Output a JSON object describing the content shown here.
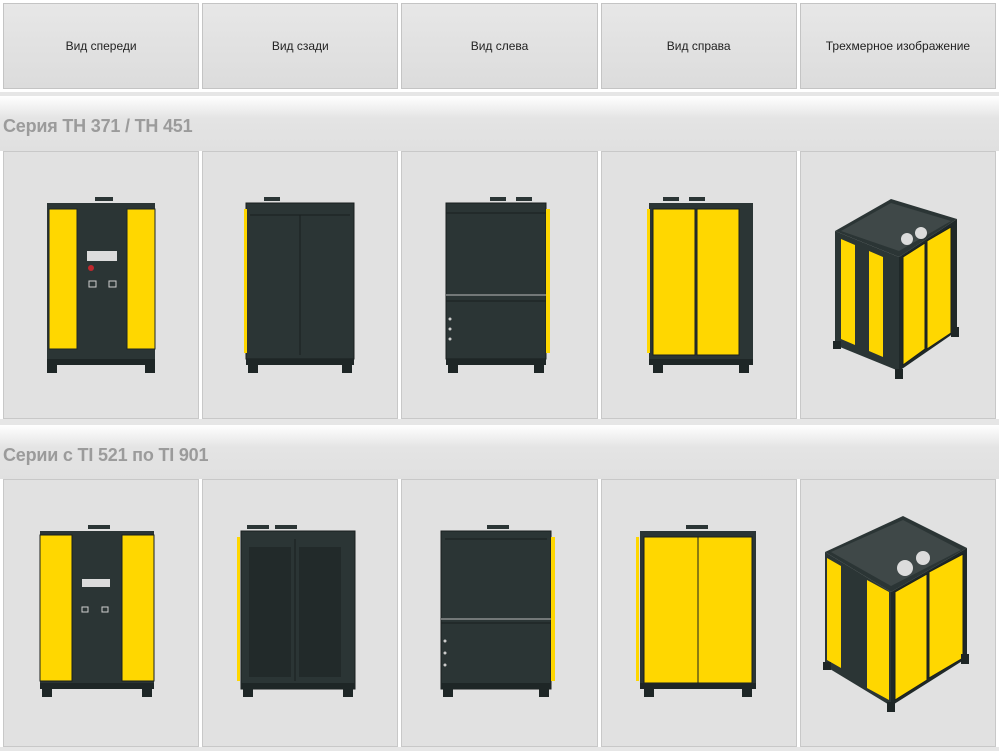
{
  "headers": [
    "Вид спереди",
    "Вид сзади",
    "Вид слева",
    "Вид справа",
    "Трехмерное изображение"
  ],
  "series": [
    {
      "title": "Серия TH 371 /  TH 451"
    },
    {
      "title": "Серии с TI 521 по TI 901"
    }
  ],
  "colors": {
    "body": "#2b3535",
    "panel": "#ffd700",
    "background": "#e1e1e1"
  }
}
